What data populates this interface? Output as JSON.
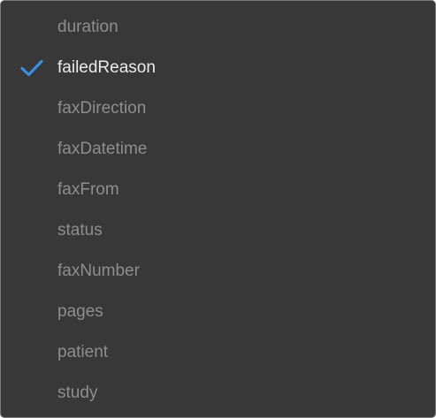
{
  "menu": {
    "selected_index": 1,
    "check_color": "#3b8fe0",
    "items": [
      {
        "label": "duration",
        "selected": false
      },
      {
        "label": "failedReason",
        "selected": true
      },
      {
        "label": "faxDirection",
        "selected": false
      },
      {
        "label": "faxDatetime",
        "selected": false
      },
      {
        "label": "faxFrom",
        "selected": false
      },
      {
        "label": "status",
        "selected": false
      },
      {
        "label": "faxNumber",
        "selected": false
      },
      {
        "label": "pages",
        "selected": false
      },
      {
        "label": "patient",
        "selected": false
      },
      {
        "label": "study",
        "selected": false
      }
    ]
  }
}
